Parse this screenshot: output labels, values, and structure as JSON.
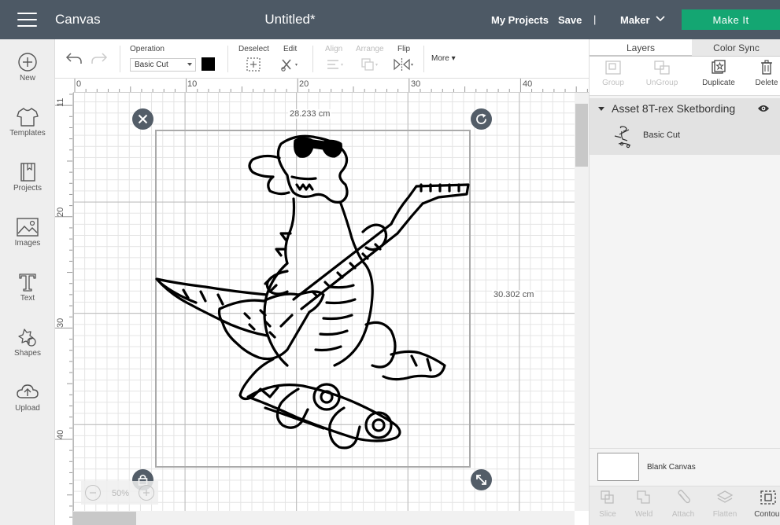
{
  "header": {
    "app_title": "Canvas",
    "doc_title": "Untitled*",
    "my_projects": "My Projects",
    "save": "Save",
    "separator": "|",
    "machine": "Maker",
    "make_it": "Make It",
    "make_it_color": "#14a672",
    "bg_color": "#4d5965"
  },
  "sidebar": {
    "items": [
      {
        "label": "New",
        "icon": "plus-circle-icon"
      },
      {
        "label": "Templates",
        "icon": "tshirt-icon"
      },
      {
        "label": "Projects",
        "icon": "book-icon"
      },
      {
        "label": "Images",
        "icon": "image-icon"
      },
      {
        "label": "Text",
        "icon": "text-t-icon"
      },
      {
        "label": "Shapes",
        "icon": "shapes-icon"
      },
      {
        "label": "Upload",
        "icon": "cloud-upload-icon"
      }
    ]
  },
  "toolbar": {
    "operation_label": "Operation",
    "operation_value": "Basic Cut",
    "color": "#000000",
    "deselect": "Deselect",
    "edit": "Edit",
    "align": "Align",
    "arrange": "Arrange",
    "flip": "Flip",
    "more": "More"
  },
  "rulers": {
    "top": [
      "0",
      "10",
      "20",
      "30",
      "40"
    ],
    "left": [
      "11",
      "20",
      "30",
      "40"
    ]
  },
  "canvas": {
    "width_label": "28.233 cm",
    "height_label": "30.302 cm",
    "zoom": "50%"
  },
  "panel": {
    "tab_layers": "Layers",
    "tab_color_sync": "Color Sync",
    "tools": {
      "group": "Group",
      "ungroup": "UnGroup",
      "duplicate": "Duplicate",
      "delete": "Delete"
    },
    "layer_group_name": "Asset 8T-rex Sketbording",
    "layer_name": "Basic Cut",
    "blank_canvas": "Blank Canvas",
    "bottom_tools": {
      "slice": "Slice",
      "weld": "Weld",
      "attach": "Attach",
      "flatten": "Flatten",
      "contour": "Contour"
    }
  }
}
